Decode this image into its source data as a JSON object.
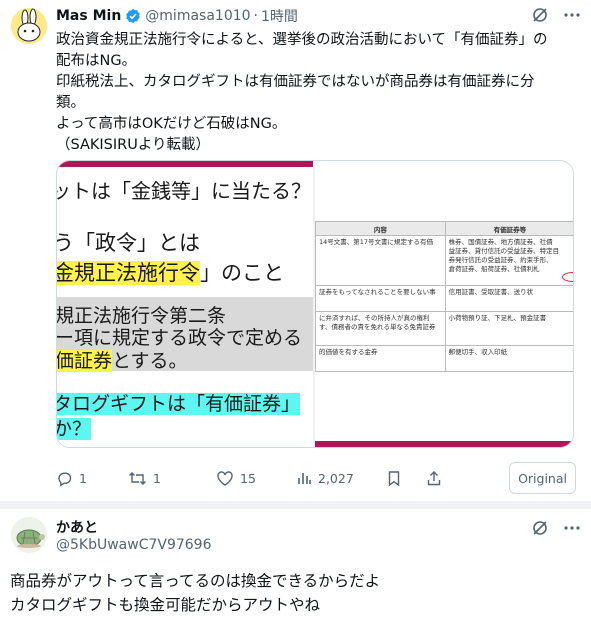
{
  "tweet": {
    "author_name": "Mas Min",
    "handle": "@mimasa1010",
    "separator": "·",
    "time": "1時間",
    "lines": [
      "政治資金規正法施行令によると、選挙後の政治活動において「有価証券」の",
      "配布はNG。",
      "印紙税法上、カタログギフトは有価証券ではないが商品券は有価証券に分",
      "類。",
      "よって高市はOKだけど石破はNG。",
      "（SAKISIRUより転載）"
    ],
    "image_left": {
      "line1": "ットは「金銭等」に当たる？",
      "line2": "う「政令」とは",
      "line3": "金規正法施行令",
      "line3b": "」のこと",
      "line4": "規正法施行令第二条",
      "line5": "ー項に規定する政令で定める",
      "line6": "価証券",
      "line6b": "とする。",
      "line7": "タログギフトは「有価証券」",
      "line8": "か？"
    },
    "image_right": {
      "col1_header": "内容",
      "col2_header": "有価証券等",
      "rows": [
        {
          "c1": [
            "14号文書、第17号文書に規定する有価",
            "",
            "",
            ""
          ],
          "c2": [
            "株券、国債証券、地方債証券、社債",
            "益証券、貸付信託の受益証券、特定目",
            "券発行信託の受益証券、約束手形、",
            "倉荷証券、船荷証券、社債利札"
          ]
        },
        {
          "c1": [
            "証券をもってなされることを要しない事"
          ],
          "c2": [
            "信用証書、受取証書、送り状"
          ]
        },
        {
          "c1": [
            "に弁済すれば、その所持人が真の権利",
            "す、債務者の責を免れる単なる免責証券"
          ],
          "c2": [
            "小荷物預り証、下足札、預金証書"
          ]
        },
        {
          "c1": [
            "的価値を有する金券"
          ],
          "c2": [
            "郵便切手、収入印紙"
          ]
        }
      ],
      "circled_text": "商品"
    },
    "actions": {
      "replies": "1",
      "retweets": "1",
      "likes": "15",
      "views": "2,027"
    },
    "original_label": "Original"
  },
  "reply": {
    "author_name": "かあと",
    "handle": "@5KbUwawC7V97696",
    "lines": [
      "商品券がアウトって言ってるのは換金できるからだよ",
      "カタログギフトも換金可能だからアウトやね"
    ]
  },
  "colors": {
    "accent": "#1d9bf0",
    "muted": "#536471",
    "highlight_yellow": "#fff24a",
    "highlight_cyan": "#5df6f0",
    "slide_bar": "#b0165a"
  }
}
